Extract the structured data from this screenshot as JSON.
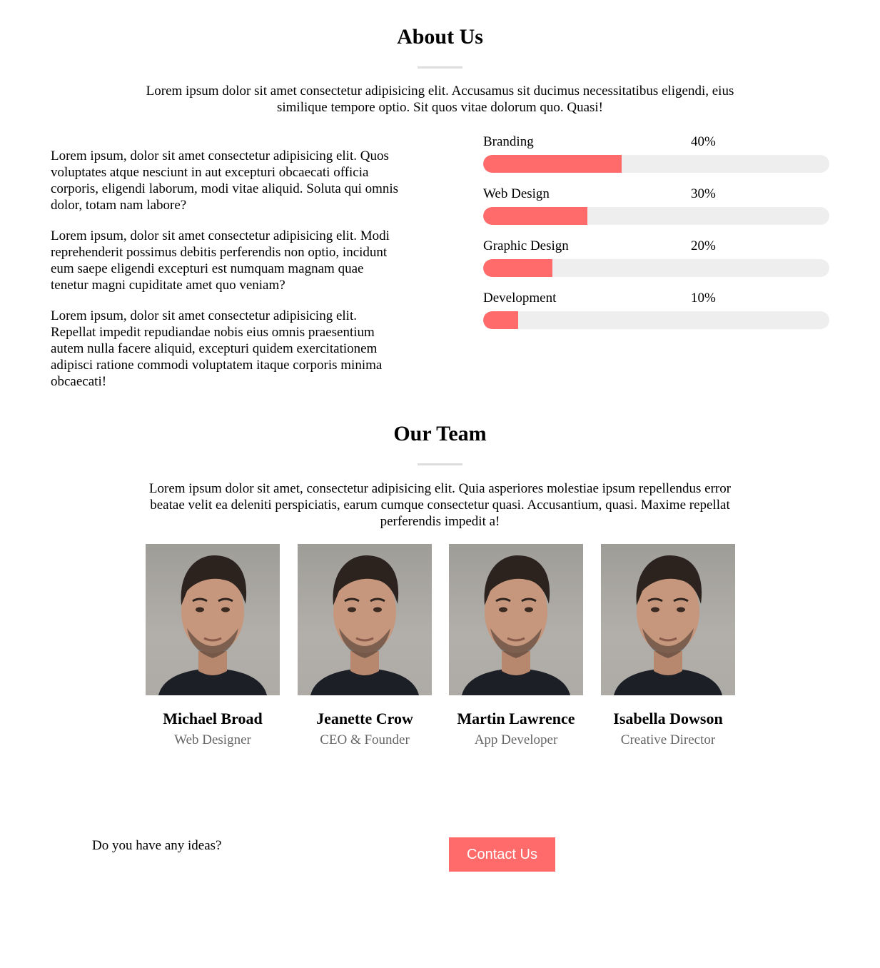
{
  "about": {
    "title": "About Us",
    "intro": "Lorem ipsum dolor sit amet consectetur adipisicing elit. Accusamus sit ducimus necessitatibus eligendi, eius similique tempore optio. Sit quos vitae dolorum quo. Quasi!",
    "paragraphs": [
      "Lorem ipsum, dolor sit amet consectetur adipisicing elit. Quos voluptates atque nesciunt in aut excepturi obcaecati officia corporis, eligendi laborum, modi vitae aliquid. Soluta qui omnis dolor, totam nam labore?",
      "Lorem ipsum, dolor sit amet consectetur adipisicing elit. Modi reprehenderit possimus debitis perferendis non optio, incidunt eum saepe eligendi excepturi est numquam magnam quae tenetur magni cupiditate amet quo veniam?",
      "Lorem ipsum, dolor sit amet consectetur adipisicing elit. Repellat impedit repudiandae nobis eius omnis praesentium autem nulla facere aliquid, excepturi quidem exercitationem adipisci ratione commodi voluptatem itaque corporis minima obcaecati!"
    ],
    "skills": [
      {
        "name": "Branding",
        "percent_label": "40%",
        "percent": 40
      },
      {
        "name": "Web Design",
        "percent_label": "30%",
        "percent": 30
      },
      {
        "name": "Graphic Design",
        "percent_label": "20%",
        "percent": 20
      },
      {
        "name": "Development",
        "percent_label": "10%",
        "percent": 10
      }
    ]
  },
  "team": {
    "title": "Our Team",
    "intro": "Lorem ipsum dolor sit amet, consectetur adipisicing elit. Quia asperiores molestiae ipsum repellendus error beatae velit ea deleniti perspiciatis, earum cumque consectetur quasi. Accusantium, quasi. Maxime repellat perferendis impedit a!",
    "members": [
      {
        "name": "Michael Broad",
        "role": "Web Designer"
      },
      {
        "name": "Jeanette Crow",
        "role": "CEO & Founder"
      },
      {
        "name": "Martin Lawrence",
        "role": "App Developer"
      },
      {
        "name": "Isabella Dowson",
        "role": "Creative Director"
      }
    ]
  },
  "contact": {
    "question": "Do you have any ideas?",
    "button_label": "Contact Us"
  },
  "colors": {
    "accent": "#ff6b6b",
    "track": "#eeeeee",
    "divider": "#dddddd",
    "role_text": "#666666"
  }
}
